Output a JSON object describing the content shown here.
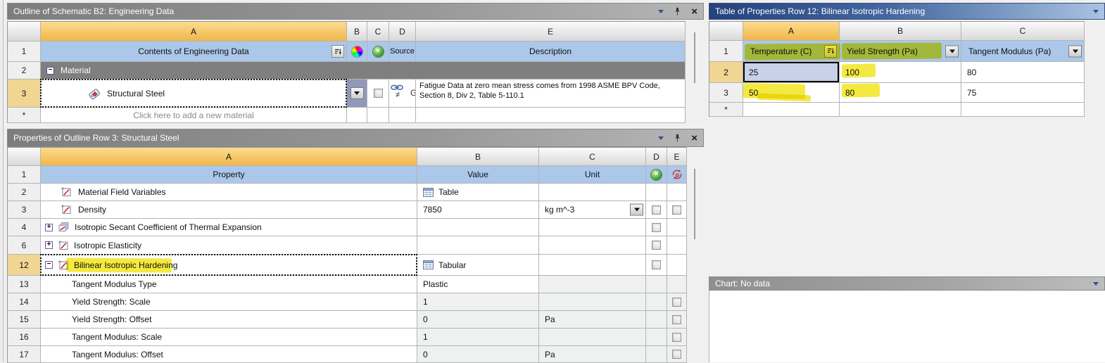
{
  "colors": {
    "accent_header_gold": "#f1b64a",
    "header_blue": "#abc8ea",
    "selected_cell_blue": "#c9d1e9",
    "highlight_marker_yellow": "#f3e51e",
    "active_titlebar_navy": "#24427c",
    "material_group_gray": "#7f7f7f"
  },
  "glyphs": {
    "close": "×",
    "not_equal": "≠"
  },
  "outline_panel": {
    "title": "Outline of Schematic B2: Engineering Data",
    "columns": [
      "A",
      "B",
      "C",
      "D",
      "E"
    ],
    "header_row": {
      "num": "1",
      "contents": "Contents of Engineering Data",
      "source": "Source",
      "description": "Description"
    },
    "material_group": {
      "num": "2",
      "label": "Material"
    },
    "material_row": {
      "num": "3",
      "name": "Structural Steel",
      "source_suffix": "G",
      "description": "Fatigue Data at zero mean stress comes from 1998 ASME BPV Code, Section 8, Div 2, Table 5-110.1"
    },
    "add_row": {
      "num": "*",
      "label": "Click here to add a new material"
    }
  },
  "properties_panel": {
    "title": "Properties of Outline Row 3: Structural Steel",
    "columns": [
      "A",
      "B",
      "C",
      "D",
      "E"
    ],
    "header_row": {
      "num": "1",
      "property": "Property",
      "value": "Value",
      "unit": "Unit"
    },
    "rows": [
      {
        "num": "2",
        "property": "Material Field Variables",
        "value": "Table",
        "unit": ""
      },
      {
        "num": "3",
        "property": "Density",
        "value": "7850",
        "unit": "kg m^-3"
      },
      {
        "num": "4",
        "property": "Isotropic Secant Coefficient of Thermal Expansion",
        "value": "",
        "unit": ""
      },
      {
        "num": "6",
        "property": "Isotropic Elasticity",
        "value": "",
        "unit": ""
      },
      {
        "num": "12",
        "property": "Bilinear Isotropic Hardening",
        "value": "Tabular",
        "unit": ""
      },
      {
        "num": "13",
        "property": "Tangent Modulus Type",
        "value": "Plastic",
        "unit": ""
      },
      {
        "num": "14",
        "property": "Yield Strength: Scale",
        "value": "1",
        "unit": ""
      },
      {
        "num": "15",
        "property": "Yield Strength: Offset",
        "value": "0",
        "unit": "Pa"
      },
      {
        "num": "16",
        "property": "Tangent Modulus: Scale",
        "value": "1",
        "unit": ""
      },
      {
        "num": "17",
        "property": "Tangent Modulus: Offset",
        "value": "0",
        "unit": "Pa"
      }
    ]
  },
  "table_panel": {
    "title": "Table of Properties Row 12: Bilinear Isotropic Hardening",
    "columns": [
      "A",
      "B",
      "C"
    ],
    "header_row": {
      "num": "1",
      "a": "Temperature (C)",
      "b": "Yield Strength (Pa)",
      "c": "Tangent Modulus (Pa)"
    },
    "rows": [
      {
        "num": "2",
        "a": "25",
        "b": "100",
        "c": "80"
      },
      {
        "num": "3",
        "a": "50",
        "b": "80",
        "c": "75"
      },
      {
        "num": "*",
        "a": "",
        "b": "",
        "c": ""
      }
    ]
  },
  "chart_panel": {
    "title": "Chart: No data"
  }
}
